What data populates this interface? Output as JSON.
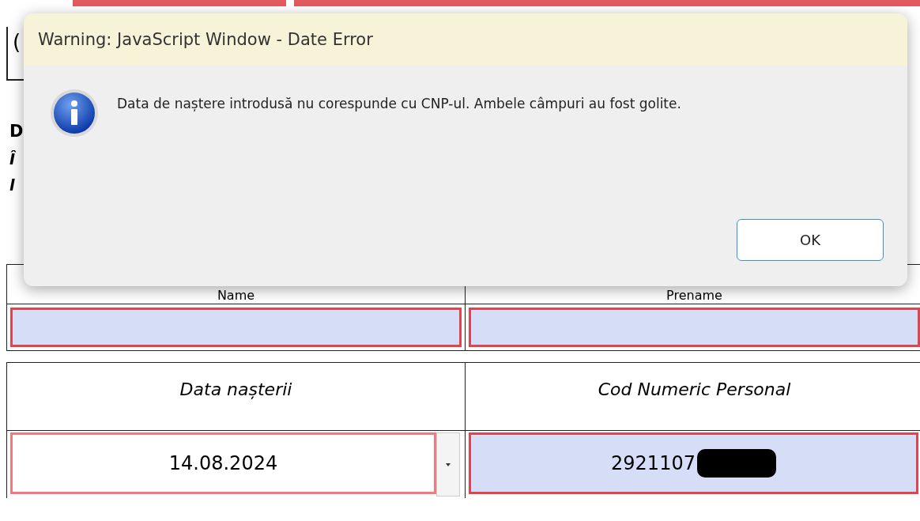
{
  "background_fragments": {
    "top": "(",
    "heading": "D",
    "lines": [
      "Î",
      "l"
    ]
  },
  "dialog": {
    "title": "Warning: JavaScript Window - Date Error",
    "message": "Data de naștere introdusă nu corespunde cu CNP-ul. Ambele câmpuri au fost golite.",
    "button": "OK"
  },
  "name_table": {
    "columns": [
      "Name",
      "Prename"
    ],
    "fields": [
      {
        "invalid": true,
        "highlighted": true
      },
      {
        "invalid": true,
        "highlighted": true
      }
    ]
  },
  "birth_table": {
    "columns": [
      "Data nașterii",
      "Cod Numeric Personal"
    ],
    "fields": [
      {
        "kind": "date",
        "value": "14.08.2024",
        "invalid": true,
        "highlighted": false
      },
      {
        "kind": "text",
        "value": "2921107",
        "invalid": true,
        "highlighted": true
      }
    ]
  }
}
